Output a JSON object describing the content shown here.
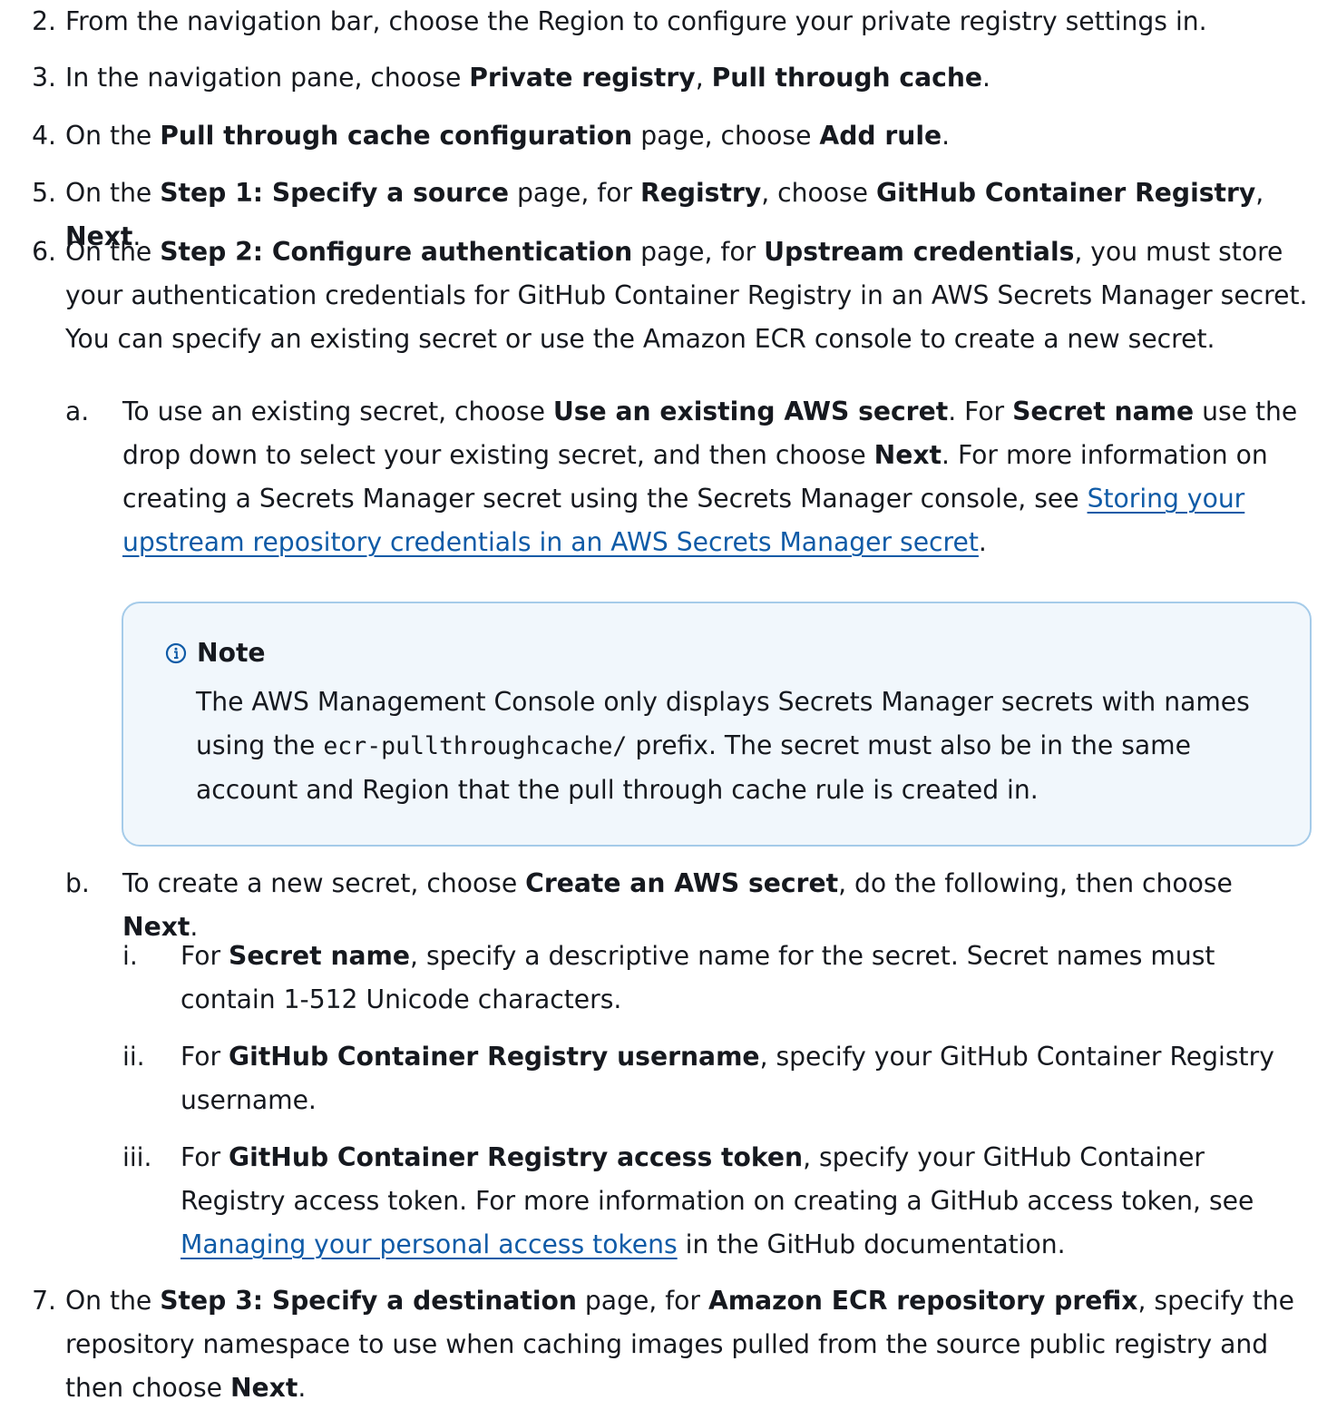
{
  "steps": {
    "s2": {
      "num": "2.",
      "t1": "From the navigation bar, choose the Region to configure your private registry settings in."
    },
    "s3": {
      "num": "3.",
      "t1": "In the navigation pane, choose ",
      "b1": "Private registry",
      "t2": ", ",
      "b2": "Pull through cache",
      "t3": "."
    },
    "s4": {
      "num": "4.",
      "t1": "On the ",
      "b1": "Pull through cache configuration",
      "t2": " page, choose ",
      "b2": "Add rule",
      "t3": "."
    },
    "s5": {
      "num": "5.",
      "t1": "On the ",
      "b1": "Step 1: Specify a source",
      "t2": " page, for ",
      "b2": "Registry",
      "t3": ", choose ",
      "b3": "GitHub Container Registry",
      "t4": ", ",
      "b4": "Next",
      "t5": "."
    },
    "s6": {
      "num": "6.",
      "t1": "On the ",
      "b1": "Step 2: Configure authentication",
      "t2": " page, for ",
      "b2": "Upstream credentials",
      "t3": ", you must store your authentication credentials for GitHub Container Registry in an AWS Secrets Manager secret. You can specify an existing secret or use the Amazon ECR console to create a new secret."
    },
    "s6a": {
      "num": "a.",
      "t1": "To use an existing secret, choose ",
      "b1": "Use an existing AWS secret",
      "t2": ". For ",
      "b2": "Secret name",
      "t3": " use the drop down to select your existing secret, and then choose ",
      "b3": "Next",
      "t4": ". For more information on creating a Secrets Manager secret using the Secrets Manager console, see ",
      "link": "Storing your upstream repository credentials in an AWS Secrets Manager secret",
      "t5": "."
    },
    "note": {
      "title": "Note",
      "t1": "The AWS Management Console only displays Secrets Manager secrets with names using the ",
      "code": "ecr-pullthroughcache/",
      "t2": " prefix. The secret must also be in the same account and Region that the pull through cache rule is created in."
    },
    "s6b": {
      "num": "b.",
      "t1": "To create a new secret, choose ",
      "b1": "Create an AWS secret",
      "t2": ", do the following, then choose ",
      "b2": "Next",
      "t3": "."
    },
    "s6bi": {
      "num": "i.",
      "t1": "For ",
      "b1": "Secret name",
      "t2": ", specify a descriptive name for the secret. Secret names must contain 1-512 Unicode characters."
    },
    "s6bii": {
      "num": "ii.",
      "t1": "For ",
      "b1": "GitHub Container Registry username",
      "t2": ", specify your GitHub Container Registry username."
    },
    "s6biii": {
      "num": "iii.",
      "t1": "For ",
      "b1": "GitHub Container Registry access token",
      "t2": ", specify your GitHub Container Registry access token. For more information on creating a GitHub access token, see ",
      "link": "Managing your personal access tokens",
      "t3": " in the GitHub documentation."
    },
    "s7": {
      "num": "7.",
      "t1": "On the ",
      "b1": "Step 3: Specify a destination",
      "t2": " page, for ",
      "b2": "Amazon ECR repository prefix",
      "t3": ", specify the repository namespace to use when caching images pulled from the source public registry and then choose ",
      "b3": "Next",
      "t4": "."
    }
  },
  "icons": {
    "note_icon": "info-icon"
  },
  "colors": {
    "text": "#16191f",
    "link": "#0f5ba7",
    "note_bg": "#f1f7fc",
    "note_border": "#a5cbe9"
  }
}
